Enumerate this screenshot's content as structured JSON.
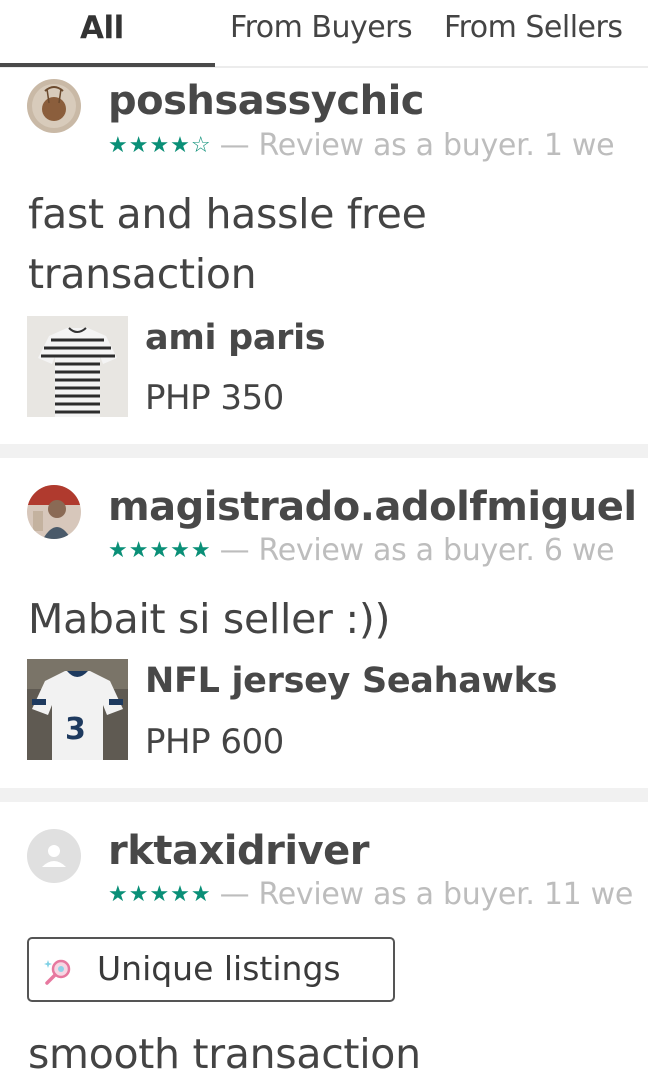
{
  "tabs": [
    {
      "label": "All",
      "active": true
    },
    {
      "label": "From Buyers",
      "active": false
    },
    {
      "label": "From Sellers",
      "active": false
    }
  ],
  "colors": {
    "star": "#0a8f77",
    "meta_text": "#bdbdbd",
    "divider": "#f1f1f1"
  },
  "reviews": [
    {
      "username": "poshsassychic",
      "rating": 4,
      "stars": "★★★★☆",
      "meta": "— Review as a buyer.  1 we",
      "comment_lines": [
        "fast and hassle free",
        "transaction"
      ],
      "item": {
        "name": "ami paris",
        "price": "PHP 350",
        "thumb_icon": "striped-shirt"
      }
    },
    {
      "username": "magistrado.adolfmiguel",
      "rating": 5,
      "stars": "★★★★★",
      "meta": "— Review as a buyer.  6 we",
      "comment_lines": [
        "Mabait si seller :))"
      ],
      "item": {
        "name": "NFL jersey Seahawks",
        "price": "PHP 600",
        "thumb_icon": "jersey"
      }
    },
    {
      "username": "rktaxidriver",
      "rating": 5,
      "stars": "★★★★★",
      "meta": "— Review as a buyer.  11 we",
      "badge": {
        "label": "Unique listings",
        "icon": "magnifier-sparkle-icon"
      },
      "comment_lines": [
        "smooth transaction"
      ]
    }
  ]
}
